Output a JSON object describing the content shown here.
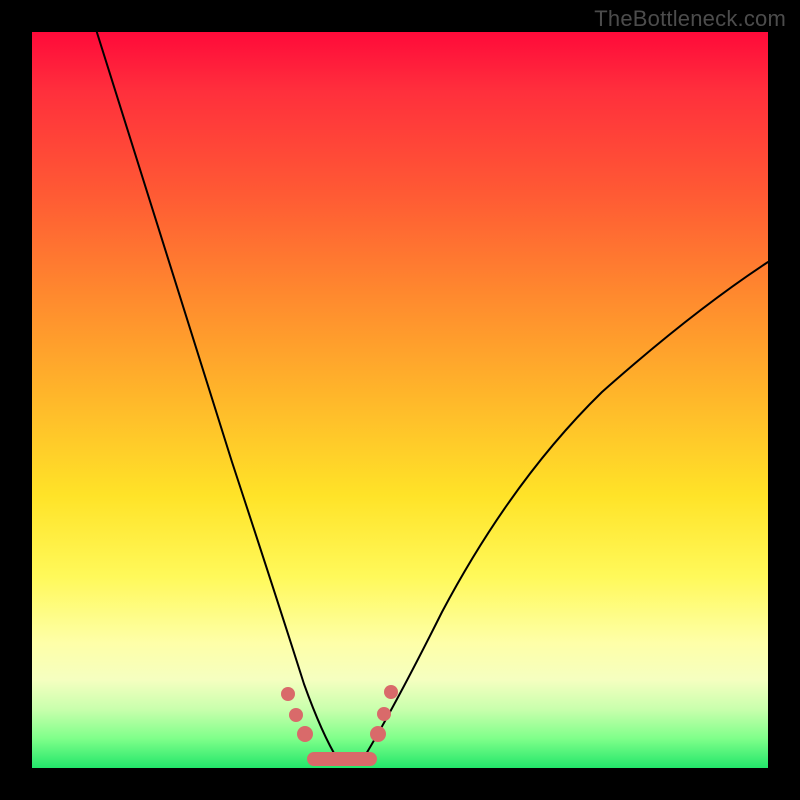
{
  "watermark": "TheBottleneck.com",
  "colors": {
    "background": "#000000",
    "curve": "#000000",
    "marker": "#d96a6a"
  },
  "chart_data": {
    "type": "line",
    "title": "",
    "xlabel": "",
    "ylabel": "",
    "xlim": [
      0,
      100
    ],
    "ylim": [
      0,
      100
    ],
    "x": [
      0,
      5,
      10,
      15,
      20,
      22,
      25,
      28,
      30,
      32,
      34,
      35,
      36,
      37,
      38,
      39,
      40,
      42,
      44,
      46,
      48,
      50,
      55,
      60,
      65,
      70,
      75,
      80,
      85,
      90,
      95,
      100
    ],
    "values": [
      110,
      99,
      86,
      72,
      56,
      49,
      38,
      26,
      18,
      11,
      6,
      4,
      2.5,
      1.6,
      1.0,
      0.6,
      0.3,
      0.0,
      0.0,
      0.4,
      1.8,
      4.0,
      10.5,
      17.5,
      24.5,
      31.0,
      37.0,
      42.5,
      47.5,
      52.0,
      56.0,
      60.0
    ],
    "minimum_region_x": [
      39,
      45
    ],
    "marker_points": [
      {
        "x": 35.5,
        "y": 10
      },
      {
        "x": 36.5,
        "y": 7
      },
      {
        "x": 37.8,
        "y": 4
      },
      {
        "x": 47.2,
        "y": 5
      },
      {
        "x": 48.0,
        "y": 8
      },
      {
        "x": 48.8,
        "y": 11
      }
    ],
    "gradient_desc": "red top to green bottom"
  }
}
